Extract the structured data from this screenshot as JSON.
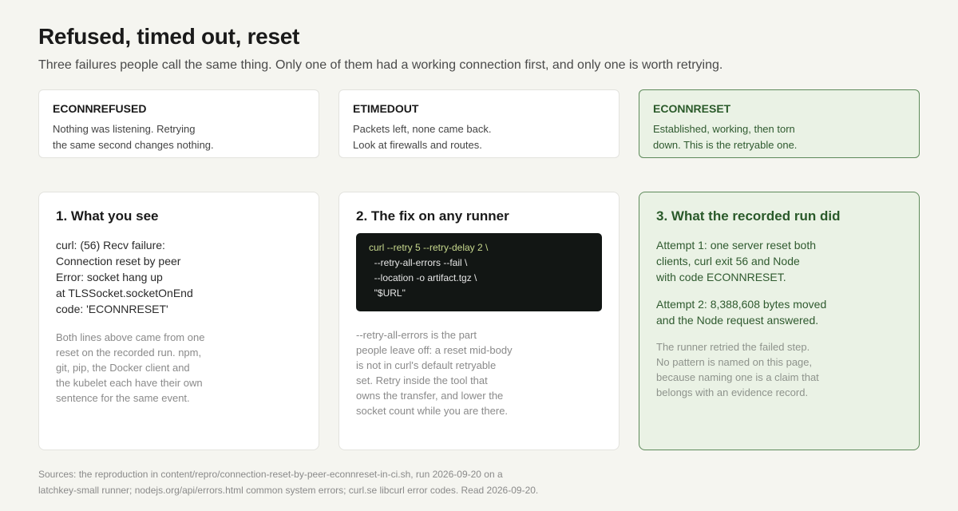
{
  "header": {
    "title": "Refused, timed out, reset",
    "subtitle": "Three failures people call the same thing. Only one of them had a working connection first, and only one is worth retrying."
  },
  "codes": [
    {
      "name": "ECONNREFUSED",
      "lines": [
        "Nothing was listening. Retrying",
        "the same second changes nothing."
      ]
    },
    {
      "name": "ETIMEDOUT",
      "lines": [
        "Packets left, none came back.",
        "Look at firewalls and routes."
      ]
    },
    {
      "name": "ECONNRESET",
      "lines": [
        "Established, working, then torn",
        "down. This is the retryable one."
      ]
    }
  ],
  "panels": {
    "see": {
      "title": "1. What you see",
      "errors": [
        "curl: (56) Recv failure:",
        "Connection reset by peer",
        "Error: socket hang up",
        "at TLSSocket.socketOnEnd",
        "code: 'ECONNRESET'"
      ],
      "note": [
        "Both lines above came from one",
        "reset on the recorded run. npm,",
        "git, pip, the Docker client and",
        "the kubelet each have their own",
        "sentence for the same event."
      ]
    },
    "fix": {
      "title": "2. The fix on any runner",
      "code": [
        "curl --retry 5 --retry-delay 2 \\",
        "  --retry-all-errors --fail \\",
        "  --location -o artifact.tgz \\",
        "  \"$URL\""
      ],
      "note": [
        "--retry-all-errors is the part",
        "people leave off: a reset mid-body",
        "is not in curl's default retryable",
        "set. Retry inside the tool that",
        "owns the transfer, and lower the",
        "socket count while you are there."
      ]
    },
    "run": {
      "title": "3. What the recorded run did",
      "attempt1": [
        "Attempt 1: one server reset both",
        "clients, curl exit 56 and Node",
        "with code ECONNRESET."
      ],
      "attempt2": [
        "Attempt 2: 8,388,608 bytes moved",
        "and the Node request answered."
      ],
      "note": [
        "The runner retried the failed step.",
        "No pattern is named on this page,",
        "because naming one is a claim that",
        "belongs with an evidence record."
      ]
    }
  },
  "sources": [
    "Sources: the reproduction in content/repro/connection-reset-by-peer-econnreset-in-ci.sh, run 2026-09-20 on a",
    "latchkey-small runner; nodejs.org/api/errors.html common system errors; curl.se libcurl error codes. Read 2026-09-20."
  ],
  "colors": {
    "background": "#f5f5f0",
    "highlight_fill": "#eaf2e5",
    "highlight_border": "#5d8a5a",
    "highlight_text": "#2a5a2a",
    "code_bg": "#121614"
  }
}
